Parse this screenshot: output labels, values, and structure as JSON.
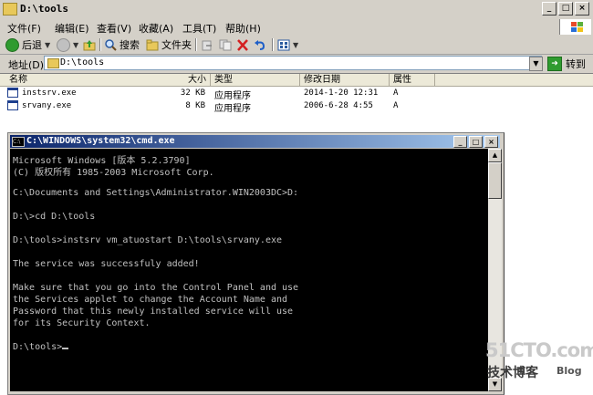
{
  "explorer": {
    "title": "D:\\tools",
    "window_buttons": [
      "_",
      "□",
      "×"
    ],
    "menu": [
      "文件(F)",
      "编辑(E)",
      "查看(V)",
      "收藏(A)",
      "工具(T)",
      "帮助(H)"
    ],
    "toolbar": {
      "back_label": "后退",
      "search_label": "搜索",
      "folders_label": "文件夹"
    },
    "address": {
      "label": "地址(D)",
      "value": "D:\\tools",
      "go_label": "转到"
    },
    "columns": [
      "名称",
      "大小",
      "类型",
      "修改日期",
      "属性"
    ],
    "files": [
      {
        "name": "instsrv.exe",
        "size": "32 KB",
        "type": "应用程序",
        "modified": "2014-1-20 12:31",
        "attr": "A"
      },
      {
        "name": "srvany.exe",
        "size": "8 KB",
        "type": "应用程序",
        "modified": "2006-6-28 4:55",
        "attr": "A"
      }
    ]
  },
  "cmd": {
    "title": "C:\\WINDOWS\\system32\\cmd.exe",
    "window_buttons": [
      "_",
      "□",
      "×"
    ],
    "lines": [
      "Microsoft Windows [版本 5.2.3790]",
      "(C) 版权所有 1985-2003 Microsoft Corp.",
      "",
      "C:\\Documents and Settings\\Administrator.WIN2003DC>D:",
      "",
      "D:\\>cd D:\\tools",
      "",
      "D:\\tools>instsrv vm_atuostart D:\\tools\\srvany.exe",
      "",
      "The service was successfuly added!",
      "",
      "Make sure that you go into the Control Panel and use",
      "the Services applet to change the Account Name and",
      "Password that this newly installed service will use",
      "for its Security Context.",
      "",
      "D:\\tools>"
    ]
  },
  "watermark": {
    "site": "51CTO.com",
    "tagline": "技术博客",
    "blog": "Blog"
  }
}
